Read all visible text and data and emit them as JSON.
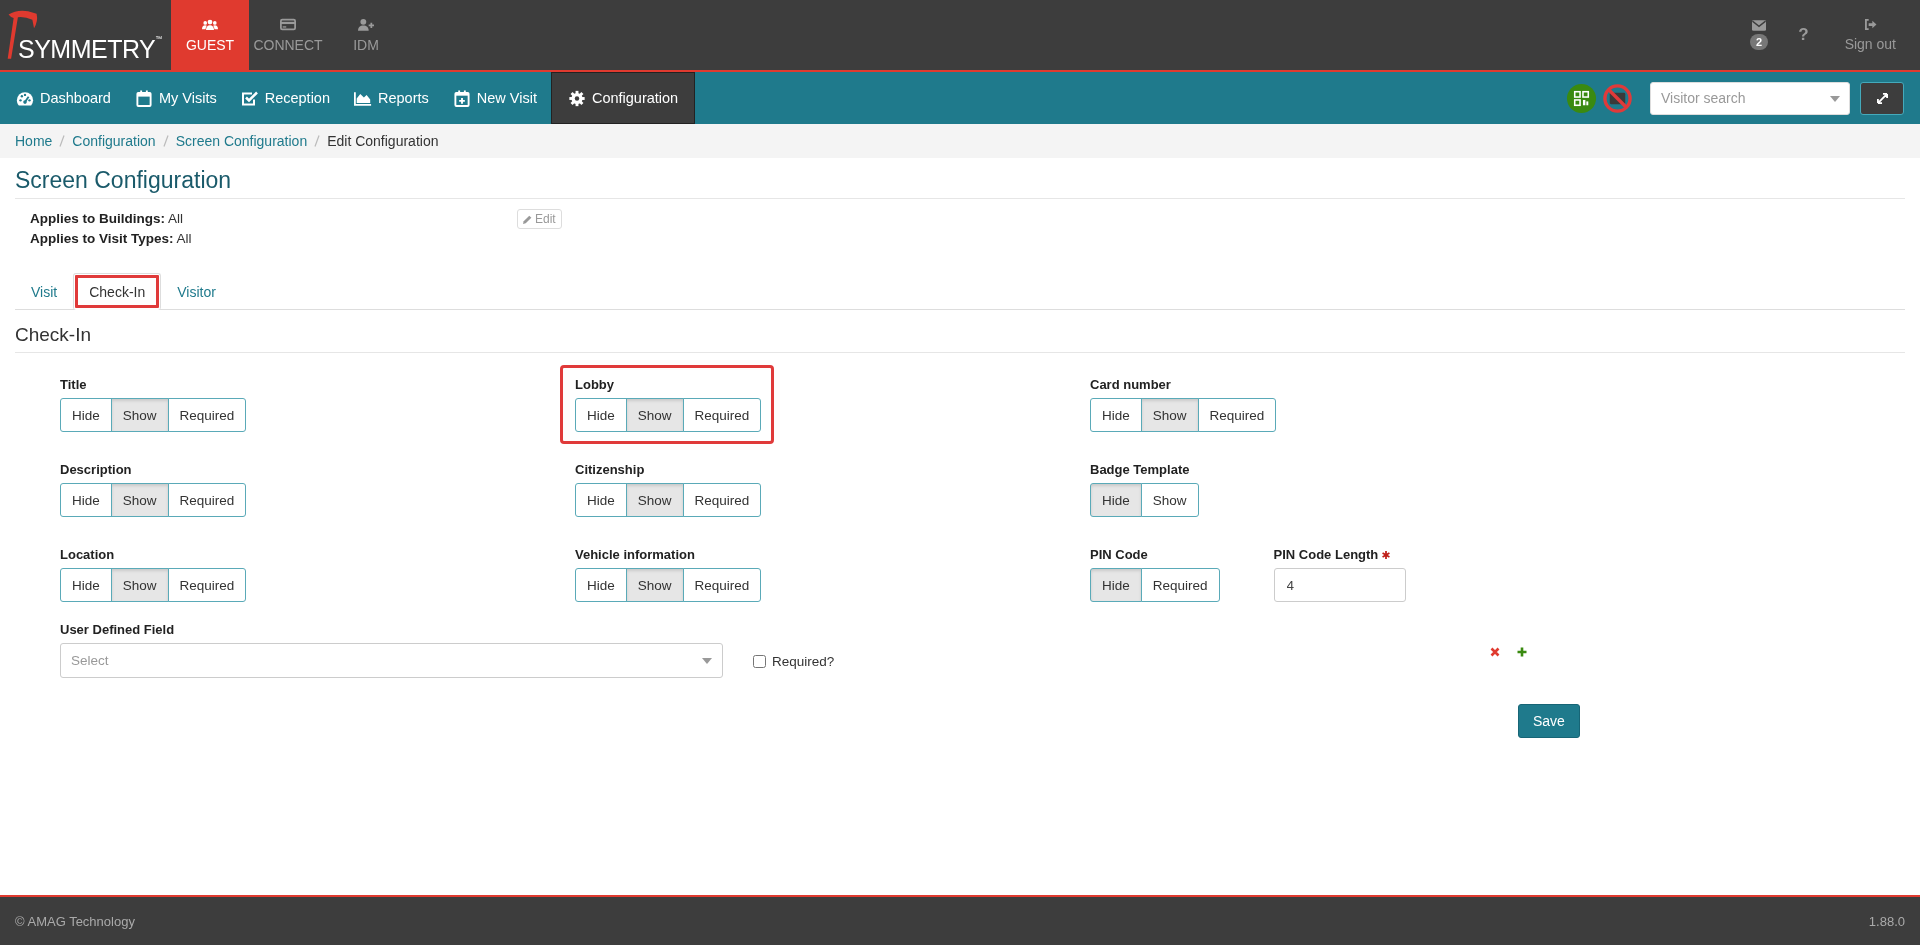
{
  "brand": {
    "name": "SYMMETRY",
    "mark": "™"
  },
  "modules": [
    {
      "label": "GUEST",
      "selected": true
    },
    {
      "label": "CONNECT",
      "selected": false
    },
    {
      "label": "IDM",
      "selected": false
    }
  ],
  "messages": {
    "count": "2"
  },
  "help": "?",
  "sign_out": "Sign out",
  "nav": [
    {
      "label": "Dashboard",
      "selected": false
    },
    {
      "label": "My Visits",
      "selected": false
    },
    {
      "label": "Reception",
      "selected": false
    },
    {
      "label": "Reports",
      "selected": false
    },
    {
      "label": "New Visit",
      "selected": false
    },
    {
      "label": "Configuration",
      "selected": true
    }
  ],
  "visitor_search": {
    "placeholder": "Visitor search"
  },
  "breadcrumb": [
    {
      "label": "Home",
      "current": false
    },
    {
      "label": "Configuration",
      "current": false
    },
    {
      "label": "Screen Configuration",
      "current": false
    },
    {
      "label": "Edit Configuration",
      "current": true
    }
  ],
  "page_title": "Screen Configuration",
  "applies": [
    {
      "label": "Applies to Buildings:",
      "value": "All"
    },
    {
      "label": "Applies to Visit Types:",
      "value": "All"
    }
  ],
  "edit_button": "Edit",
  "tabs": [
    {
      "label": "Visit",
      "selected": false,
      "highlighted": false
    },
    {
      "label": "Check-In",
      "selected": true,
      "highlighted": true
    },
    {
      "label": "Visitor",
      "selected": false,
      "highlighted": false
    }
  ],
  "section_title": "Check-In",
  "field_rows": [
    [
      [
        {
          "kind": "toggle",
          "label": "Title",
          "highlighted": false,
          "options": [
            {
              "label": "Hide",
              "selected": false
            },
            {
              "label": "Show",
              "selected": true
            },
            {
              "label": "Required",
              "selected": false
            }
          ]
        }
      ],
      [
        {
          "kind": "toggle",
          "label": "Lobby",
          "highlighted": true,
          "options": [
            {
              "label": "Hide",
              "selected": false
            },
            {
              "label": "Show",
              "selected": true
            },
            {
              "label": "Required",
              "selected": false
            }
          ]
        }
      ],
      [
        {
          "kind": "toggle",
          "label": "Card number",
          "highlighted": false,
          "options": [
            {
              "label": "Hide",
              "selected": false
            },
            {
              "label": "Show",
              "selected": true
            },
            {
              "label": "Required",
              "selected": false
            }
          ]
        }
      ]
    ],
    [
      [
        {
          "kind": "toggle",
          "label": "Description",
          "highlighted": false,
          "options": [
            {
              "label": "Hide",
              "selected": false
            },
            {
              "label": "Show",
              "selected": true
            },
            {
              "label": "Required",
              "selected": false
            }
          ]
        }
      ],
      [
        {
          "kind": "toggle",
          "label": "Citizenship",
          "highlighted": false,
          "options": [
            {
              "label": "Hide",
              "selected": false
            },
            {
              "label": "Show",
              "selected": true
            },
            {
              "label": "Required",
              "selected": false
            }
          ]
        }
      ],
      [
        {
          "kind": "toggle",
          "label": "Badge Template",
          "highlighted": false,
          "options": [
            {
              "label": "Hide",
              "selected": true
            },
            {
              "label": "Show",
              "selected": false
            }
          ]
        }
      ]
    ],
    [
      [
        {
          "kind": "toggle",
          "label": "Location",
          "highlighted": false,
          "options": [
            {
              "label": "Hide",
              "selected": false
            },
            {
              "label": "Show",
              "selected": true
            },
            {
              "label": "Required",
              "selected": false
            }
          ]
        }
      ],
      [
        {
          "kind": "toggle",
          "label": "Vehicle information",
          "highlighted": false,
          "options": [
            {
              "label": "Hide",
              "selected": false
            },
            {
              "label": "Show",
              "selected": true
            },
            {
              "label": "Required",
              "selected": false
            }
          ]
        }
      ],
      [
        {
          "kind": "toggle",
          "label": "PIN Code",
          "highlighted": false,
          "options": [
            {
              "label": "Hide",
              "selected": true
            },
            {
              "label": "Required",
              "selected": false
            }
          ]
        },
        {
          "kind": "input",
          "label": "PIN Code Length",
          "required": true,
          "value": "4"
        }
      ]
    ]
  ],
  "user_defined_field": {
    "label": "User Defined Field",
    "placeholder": "Select",
    "required_label": "Required?",
    "required_checked": false
  },
  "save_button": "Save",
  "footer": {
    "copyright": "© AMAG Technology",
    "version": "1.88.0"
  }
}
